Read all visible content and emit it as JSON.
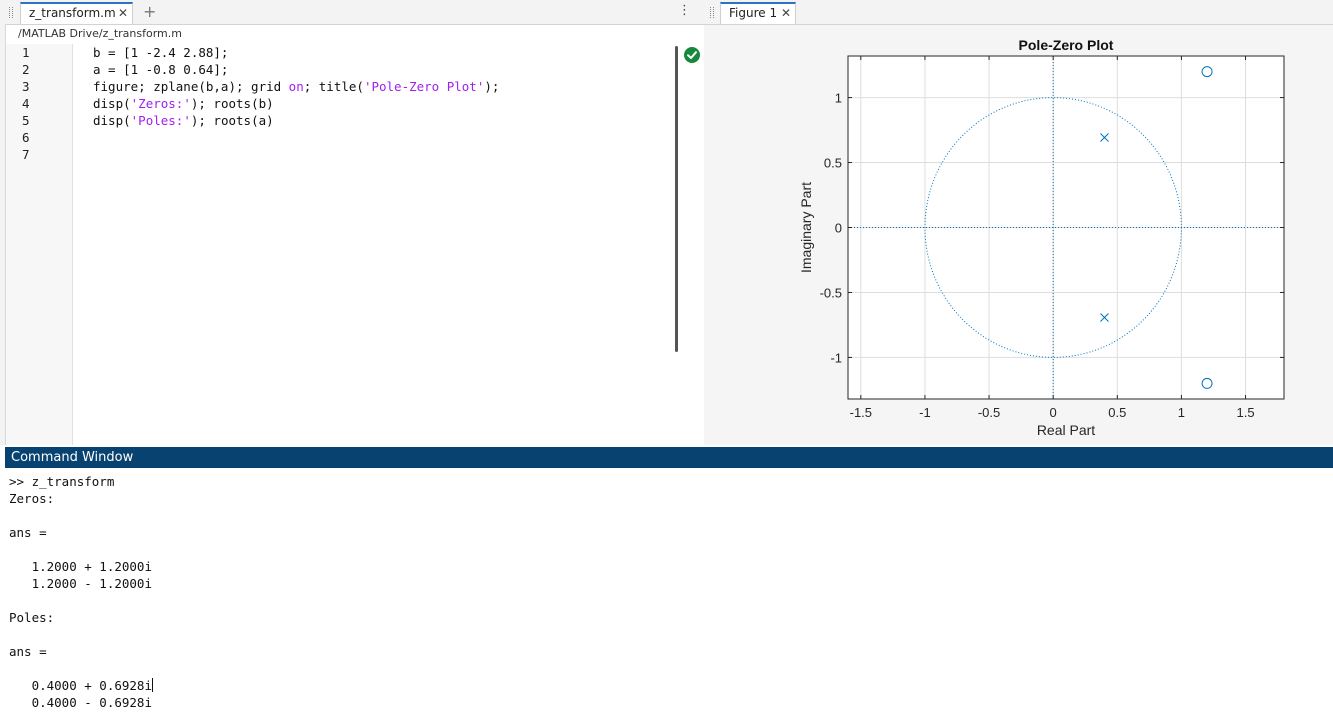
{
  "editor": {
    "tab_title": "z_transform.m",
    "file_path": "/MATLAB Drive/z_transform.m",
    "lines": [
      {
        "num": "1",
        "parts": [
          {
            "t": "b = [1 -2.4 2.88];",
            "s": false
          }
        ]
      },
      {
        "num": "2",
        "parts": [
          {
            "t": "a = [1 -0.8 0.64];",
            "s": false
          }
        ]
      },
      {
        "num": "3",
        "parts": [
          {
            "t": "figure; zplane(b,a); grid ",
            "s": false
          },
          {
            "t": "on",
            "s": true
          },
          {
            "t": "; title(",
            "s": false
          },
          {
            "t": "'Pole-Zero Plot'",
            "s": true
          },
          {
            "t": ");",
            "s": false
          }
        ]
      },
      {
        "num": "4",
        "parts": [
          {
            "t": "disp(",
            "s": false
          },
          {
            "t": "'Zeros:'",
            "s": true
          },
          {
            "t": "); roots(b)",
            "s": false
          }
        ]
      },
      {
        "num": "5",
        "parts": [
          {
            "t": "disp(",
            "s": false
          },
          {
            "t": "'Poles:'",
            "s": true
          },
          {
            "t": "); roots(a)",
            "s": false
          }
        ]
      },
      {
        "num": "6",
        "parts": []
      },
      {
        "num": "7",
        "parts": []
      }
    ]
  },
  "figure": {
    "tab_title": "Figure 1"
  },
  "chart_data": {
    "type": "scatter",
    "title": "Pole-Zero Plot",
    "xlabel": "Real Part",
    "ylabel": "Imaginary Part",
    "xlim": [
      -1.6,
      1.8
    ],
    "ylim": [
      -1.32,
      1.32
    ],
    "xticks": [
      -1.5,
      -1,
      -0.5,
      0,
      0.5,
      1,
      1.5
    ],
    "xtick_labels": [
      "-1.5",
      "-1",
      "-0.5",
      "0",
      "0.5",
      "1",
      "1.5"
    ],
    "yticks": [
      -1,
      -0.5,
      0,
      0.5,
      1
    ],
    "ytick_labels": [
      "-1",
      "-0.5",
      "0",
      "0.5",
      "1"
    ],
    "grid": true,
    "unit_circle": true,
    "zeros": [
      {
        "x": 1.2,
        "y": 1.2
      },
      {
        "x": 1.2,
        "y": -1.2
      }
    ],
    "poles": [
      {
        "x": 0.4,
        "y": 0.6928
      },
      {
        "x": 0.4,
        "y": -0.6928
      }
    ],
    "color": "#0072bd"
  },
  "command_window": {
    "title": "Command Window",
    "lines": [
      ">> z_transform",
      "Zeros:",
      "",
      "ans =",
      "",
      "   1.2000 + 1.2000i",
      "   1.2000 - 1.2000i",
      "",
      "Poles:",
      "",
      "ans =",
      "",
      "   0.4000 + 0.6928i",
      "   0.4000 - 0.6928i"
    ],
    "caret_line": 12
  },
  "colors": {
    "command_header_bg": "#084270",
    "tab_accent": "#2f72c4",
    "string_color": "#a020f0",
    "ok_green": "#16883b"
  }
}
